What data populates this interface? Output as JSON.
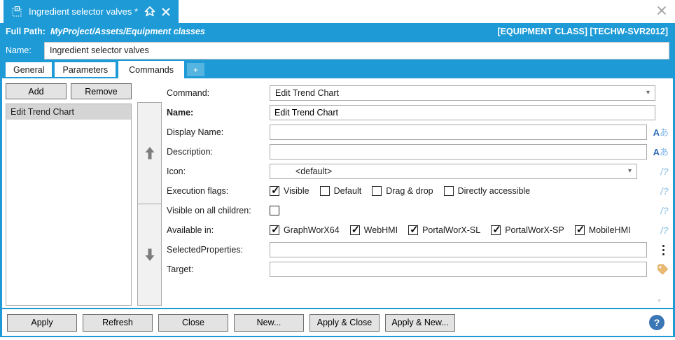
{
  "colors": {
    "accent_blue": "#1E9BD7",
    "plus_tab_blue": "#55B5E0",
    "help_blue": "#3B76B5",
    "tag_tan": "#E8B568",
    "translate_blue": "#2F6BB8",
    "expression_blue": "#A8CFE9"
  },
  "window": {
    "tab_title": "Ingredient selector valves *"
  },
  "header": {
    "full_path_label": "Full Path:",
    "full_path_value": "MyProject/Assets/Equipment classes",
    "context": "[EQUIPMENT CLASS] [TECHW-SVR2012]",
    "name_label": "Name:",
    "name_value": "Ingredient selector valves"
  },
  "tabs": [
    {
      "label": "General",
      "selected": false
    },
    {
      "label": "Parameters",
      "selected": false
    },
    {
      "label": "Commands",
      "selected": true
    },
    {
      "label": "+",
      "selected": false
    }
  ],
  "commands_list": {
    "add_label": "Add",
    "remove_label": "Remove",
    "items": [
      {
        "label": "Edit Trend Chart",
        "selected": true
      }
    ]
  },
  "form": {
    "command": {
      "label": "Command:",
      "value": "Edit Trend Chart"
    },
    "name": {
      "label": "Name:",
      "value": "Edit Trend Chart"
    },
    "display_name": {
      "label": "Display Name:",
      "value": ""
    },
    "description": {
      "label": "Description:",
      "value": ""
    },
    "icon": {
      "label": "Icon:",
      "value": "<default>"
    },
    "execution_flags": {
      "label": "Execution flags:",
      "options": [
        {
          "label": "Visible",
          "checked": true
        },
        {
          "label": "Default",
          "checked": false
        },
        {
          "label": "Drag & drop",
          "checked": false
        },
        {
          "label": "Directly accessible",
          "checked": false
        }
      ]
    },
    "visible_on_all_children": {
      "label": "Visible on all children:",
      "checked": false
    },
    "available_in": {
      "label": "Available in:",
      "options": [
        {
          "label": "GraphWorX64",
          "checked": true
        },
        {
          "label": "WebHMI",
          "checked": true
        },
        {
          "label": "PortalWorX-SL",
          "checked": true
        },
        {
          "label": "PortalWorX-SP",
          "checked": true
        },
        {
          "label": "MobileHMI",
          "checked": true
        }
      ]
    },
    "selected_properties": {
      "label": "SelectedProperties:",
      "value": ""
    },
    "target": {
      "label": "Target:",
      "value": ""
    }
  },
  "icons": {
    "dropdown": "▾",
    "translate_a": "A",
    "translate_kana": "あ",
    "expression": "/?",
    "ellipsis": "⋮",
    "help": "?"
  },
  "footer": {
    "buttons": [
      {
        "label": "Apply"
      },
      {
        "label": "Refresh"
      },
      {
        "label": "Close"
      },
      {
        "label": "New..."
      },
      {
        "label": "Apply & Close"
      },
      {
        "label": "Apply & New..."
      }
    ]
  }
}
